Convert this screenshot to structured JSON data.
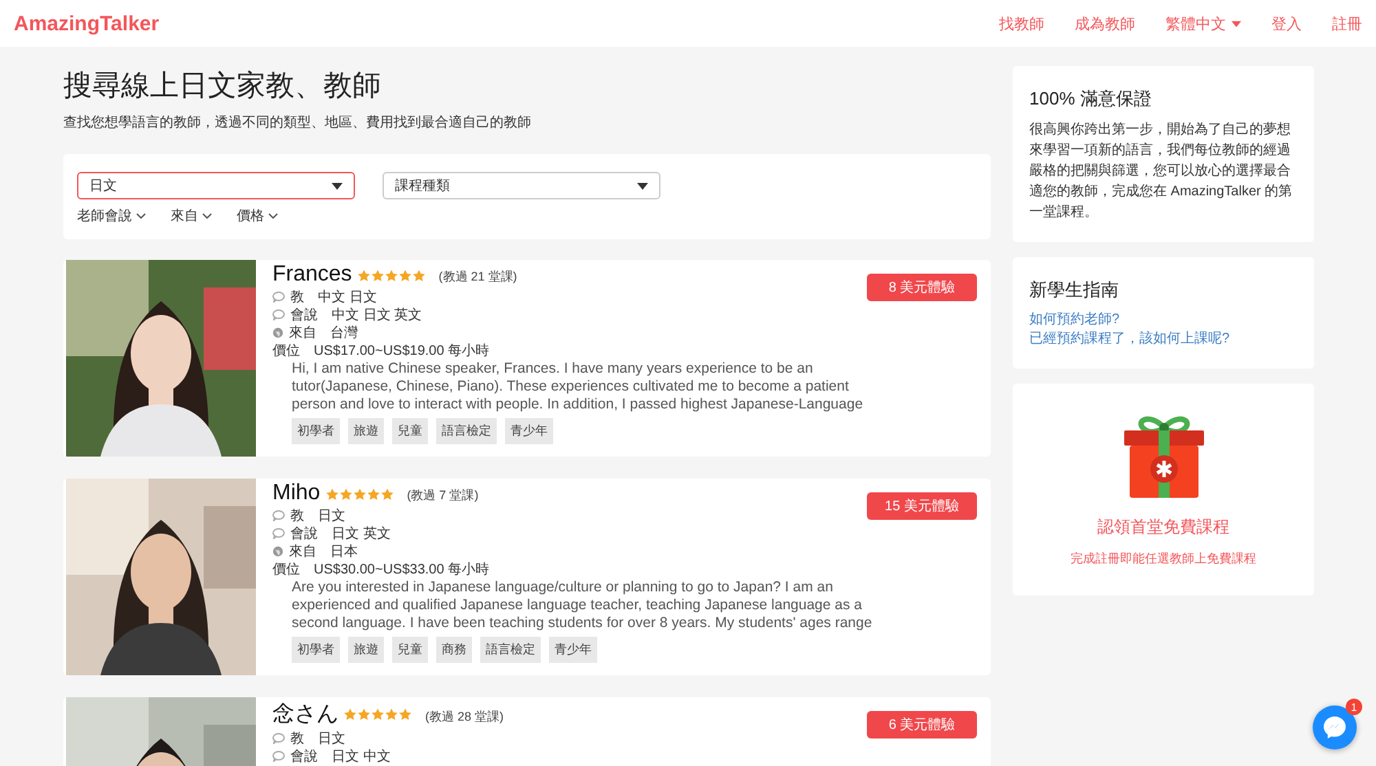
{
  "nav": {
    "logo": "AmazingTalker",
    "links": [
      {
        "label": "找教師",
        "dropdown": false
      },
      {
        "label": "成為教師",
        "dropdown": false
      },
      {
        "label": "繁體中文",
        "dropdown": true
      },
      {
        "label": "登入",
        "dropdown": false
      },
      {
        "label": "註冊",
        "dropdown": false
      }
    ]
  },
  "heading": {
    "title": "搜尋線上日文家教、教師",
    "subtitle": "查找您想學語言的教師，透過不同的類型、地區、費用找到最合適自己的教師"
  },
  "filters": {
    "selects": [
      {
        "value": "日文",
        "focused": true
      },
      {
        "value": "課程種類",
        "focused": false
      }
    ],
    "dropdowns": [
      "老師會說",
      "來自",
      "價格"
    ]
  },
  "teachers": [
    {
      "name": "Frances",
      "stars": 5,
      "lessons": "(教過 21 堂課)",
      "cta": "8 美元體驗",
      "details": [
        {
          "kind": "speech",
          "label": "教",
          "value": "中文 日文"
        },
        {
          "kind": "speech",
          "label": "會說",
          "value": "中文 日文 英文"
        },
        {
          "kind": "globe",
          "label": "來自",
          "value": "台灣"
        },
        {
          "kind": "plain",
          "label": "價位",
          "value": "US$17.00~US$19.00 每小時"
        }
      ],
      "bio": "Hi, I am native Chinese speaker, Frances. I have many years experience to be an tutor(Japanese, Chinese, Piano). These experiences cultivated me to become a patient person and love to interact with people. In addition, I passed highest Japanese-Language",
      "tags": [
        "初學者",
        "旅遊",
        "兒童",
        "語言檢定",
        "青少年"
      ]
    },
    {
      "name": "Miho",
      "stars": 5,
      "lessons": "(教過 7 堂課)",
      "cta": "15 美元體驗",
      "details": [
        {
          "kind": "speech",
          "label": "教",
          "value": "日文"
        },
        {
          "kind": "speech",
          "label": "會說",
          "value": "日文 英文"
        },
        {
          "kind": "globe",
          "label": "來自",
          "value": "日本"
        },
        {
          "kind": "plain",
          "label": "價位",
          "value": "US$30.00~US$33.00 每小時"
        }
      ],
      "bio": "Are you interested in Japanese language/culture or planning to go to Japan? I am an experienced and qualified Japanese language teacher, teaching Japanese language as a second language. I have been teaching students for over 8 years. My students' ages range",
      "tags": [
        "初學者",
        "旅遊",
        "兒童",
        "商務",
        "語言檢定",
        "青少年"
      ]
    },
    {
      "name": "念さん",
      "stars": 5,
      "lessons": "(教過 28 堂課)",
      "cta": "6 美元體驗",
      "details": [
        {
          "kind": "speech",
          "label": "教",
          "value": "日文"
        },
        {
          "kind": "speech",
          "label": "會說",
          "value": "日文 中文"
        }
      ]
    }
  ],
  "sidebar": {
    "guarantee": {
      "title": "100% 滿意保證",
      "text": "很高興你跨出第一步，開始為了自己的夢想來學習一項新的語言，我們每位教師的經過嚴格的把關與篩選，您可以放心的選擇最合適您的教師，完成您在 AmazingTalker 的第一堂課程。"
    },
    "guide": {
      "title": "新學生指南",
      "links": [
        "如何預約老師?",
        "已經預約課程了，該如何上課呢?"
      ]
    },
    "promo": {
      "title": "認領首堂免費課程",
      "text": "完成註冊即能任選教師上免費課程"
    }
  },
  "messenger": {
    "badge": "1"
  }
}
